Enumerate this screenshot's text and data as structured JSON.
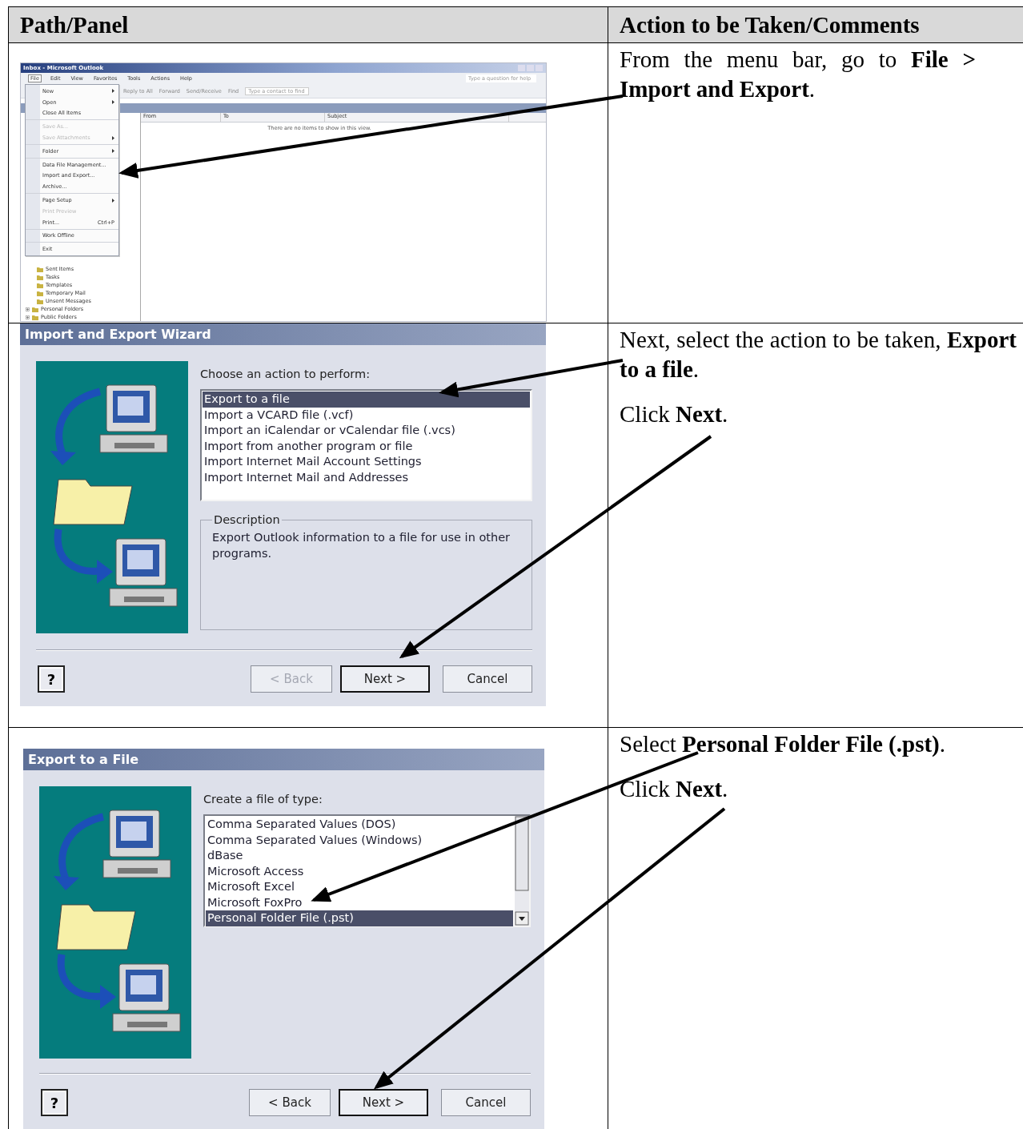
{
  "table": {
    "columns": [
      "Path/Panel",
      "Action to be Taken/Comments"
    ],
    "rows": [
      {
        "panel": {
          "kind": "outlook",
          "title": "Inbox - Microsoft Outlook",
          "menus": [
            {
              "label": "File",
              "open": true
            },
            {
              "label": "Edit",
              "open": false
            },
            {
              "label": "View",
              "open": false
            },
            {
              "label": "Favorites",
              "open": false
            },
            {
              "label": "Tools",
              "open": false
            },
            {
              "label": "Actions",
              "open": false
            },
            {
              "label": "Help",
              "open": false
            }
          ],
          "toolbar": [
            "Reply to All",
            "Forward",
            "Send/Receive",
            "Find"
          ],
          "contact_placeholder": "Type a contact to find",
          "help_placeholder": "Type a question for help",
          "columns": [
            "From",
            "To",
            "Subject"
          ],
          "empty_message": "There are no items to show in this view.",
          "file_menu": [
            [
              {
                "label": "New",
                "submenu": true,
                "disabled": false
              },
              {
                "label": "Open",
                "submenu": true,
                "disabled": false
              },
              {
                "label": "Close All Items",
                "submenu": false,
                "disabled": false
              }
            ],
            [
              {
                "label": "Save As...",
                "submenu": false,
                "disabled": true
              },
              {
                "label": "Save Attachments",
                "submenu": true,
                "disabled": true
              }
            ],
            [
              {
                "label": "Folder",
                "submenu": true,
                "disabled": false
              }
            ],
            [
              {
                "label": "Data File Management...",
                "submenu": false,
                "disabled": false
              },
              {
                "label": "Import and Export...",
                "submenu": false,
                "disabled": false
              },
              {
                "label": "Archive...",
                "submenu": false,
                "disabled": false
              }
            ],
            [
              {
                "label": "Page Setup",
                "submenu": true,
                "disabled": false
              },
              {
                "label": "Print Preview",
                "submenu": false,
                "disabled": true
              },
              {
                "label": "Print...",
                "shortcut": "Ctrl+P",
                "submenu": false,
                "disabled": false
              }
            ],
            [
              {
                "label": "Work Offline",
                "submenu": false,
                "disabled": false
              }
            ],
            [
              {
                "label": "Exit",
                "submenu": false,
                "disabled": false
              }
            ]
          ],
          "subfolders": [
            "Sent Items",
            "Tasks",
            "Templates",
            "Temporary Mail",
            "Unsent Messages"
          ],
          "root_folders": [
            {
              "label": "Personal Folders",
              "expanded": false
            },
            {
              "label": "Public Folders",
              "expanded": false
            }
          ]
        },
        "comments": [
          "From the menu bar, go to **File > Import and Export**."
        ]
      },
      {
        "panel": {
          "kind": "wizard",
          "title": "Import and Export Wizard",
          "prompt": "Choose an action to perform:",
          "options": [
            {
              "label": "Export to a file",
              "selected": true
            },
            {
              "label": "Import a VCARD file (.vcf)",
              "selected": false
            },
            {
              "label": "Import an iCalendar or vCalendar file (.vcs)",
              "selected": false
            },
            {
              "label": "Import from another program or file",
              "selected": false
            },
            {
              "label": "Import Internet Mail Account Settings",
              "selected": false
            },
            {
              "label": "Import Internet Mail and Addresses",
              "selected": false
            }
          ],
          "description_label": "Description",
          "description": "Export Outlook information to a file for use in other programs.",
          "help_button": "?",
          "buttons": [
            {
              "label": "< Back",
              "disabled": true,
              "default": false
            },
            {
              "label": "Next >",
              "disabled": false,
              "default": true
            },
            {
              "label": "Cancel",
              "disabled": false,
              "default": false
            }
          ]
        },
        "comments": [
          "Next, select the action to be taken, **Export to a file**.",
          "Click **Next**."
        ]
      },
      {
        "panel": {
          "kind": "wizard",
          "title": "Export to a File",
          "prompt": "Create a file of type:",
          "scrollbar": true,
          "options": [
            {
              "label": "Comma Separated Values (DOS)",
              "selected": false
            },
            {
              "label": "Comma Separated Values (Windows)",
              "selected": false
            },
            {
              "label": "dBase",
              "selected": false
            },
            {
              "label": "Microsoft Access",
              "selected": false
            },
            {
              "label": "Microsoft Excel",
              "selected": false
            },
            {
              "label": "Microsoft FoxPro",
              "selected": false
            },
            {
              "label": "Personal Folder File (.pst)",
              "selected": true
            }
          ],
          "help_button": "?",
          "buttons": [
            {
              "label": "< Back",
              "disabled": false,
              "default": false
            },
            {
              "label": "Next >",
              "disabled": false,
              "default": true
            },
            {
              "label": "Cancel",
              "disabled": false,
              "default": false
            }
          ]
        },
        "comments": [
          "Select **Personal Folder File (.pst)**.",
          "Click **Next**."
        ]
      }
    ]
  }
}
